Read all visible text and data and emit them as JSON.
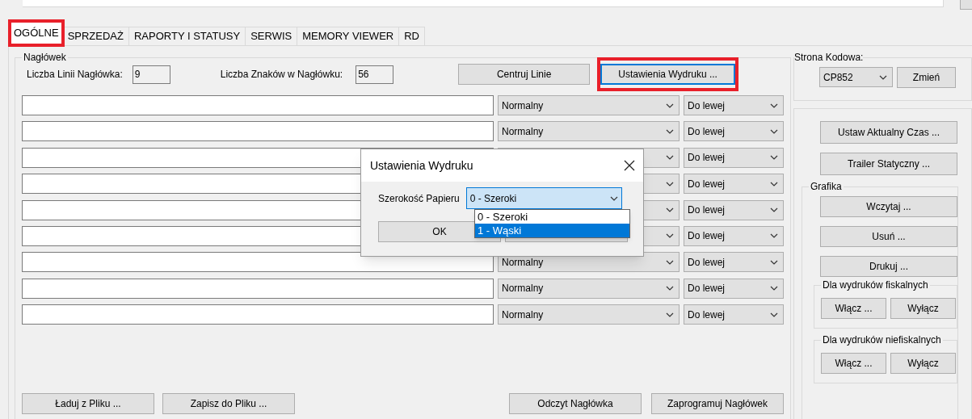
{
  "tabs": [
    {
      "label": "OGÓLNE",
      "selected": true,
      "highlighted": true
    },
    {
      "label": "SPRZEDAŻ",
      "selected": false,
      "highlighted": false
    },
    {
      "label": "RAPORTY I STATUSY",
      "selected": false,
      "highlighted": false
    },
    {
      "label": "SERWIS",
      "selected": false,
      "highlighted": false
    },
    {
      "label": "MEMORY VIEWER",
      "selected": false,
      "highlighted": false
    },
    {
      "label": "RD",
      "selected": false,
      "highlighted": false
    }
  ],
  "header_group": {
    "title": "Nagłówek",
    "line_count_label": "Liczba Linii Nagłówka:",
    "line_count": "9",
    "char_count_label": "Liczba Znaków w Nagłówku:",
    "char_count": "56",
    "buttons": [
      {
        "label": "Centruj Linie",
        "highlighted": false,
        "focused": false
      },
      {
        "label": "Ustawienia Wydruku ...",
        "highlighted": true,
        "focused": true
      }
    ]
  },
  "header_lines": [
    {
      "style": "Normalny",
      "align": "Do lewej"
    },
    {
      "style": "Normalny",
      "align": "Do lewej"
    },
    {
      "align": "Do lewej"
    },
    {
      "align": "Do lewej"
    },
    {
      "align": "Do lewej"
    },
    {
      "align": "Do lewej"
    },
    {
      "style": "Normalny",
      "align": "Do lewej"
    },
    {
      "style": "Normalny",
      "align": "Do lewej"
    },
    {
      "style": "Normalny",
      "align": "Do lewej"
    }
  ],
  "file_buttons": [
    "Ładuj z Pliku ...",
    "Zapisz do Pliku ..."
  ],
  "header_actions": [
    "Odczyt Nagłówka",
    "Zaprogramuj Nagłówek"
  ],
  "code_page": {
    "title": "Strona Kodowa:",
    "value": "CP852",
    "button": "Zmień"
  },
  "right_buttons": [
    "Ustaw Aktualny Czas ...",
    "Trailer Statyczny ..."
  ],
  "graphics": {
    "title": "Grafika",
    "buttons": [
      "Wczytaj ...",
      "Usuń ...",
      "Drukuj ..."
    ],
    "groups": [
      {
        "title": "Dla wydruków fiskalnych",
        "buttons": [
          "Włącz ...",
          "Wyłącz"
        ]
      },
      {
        "title": "Dla wydruków niefiskalnych",
        "buttons": [
          "Włącz ...",
          "Wyłącz"
        ]
      }
    ]
  },
  "dialog": {
    "title": "Ustawienia Wydruku",
    "label": "Szerokość Papieru",
    "value": "0 - Szeroki",
    "options": [
      {
        "label": "0 - Szeroki",
        "highlighted": false
      },
      {
        "label": "1 - Wąski",
        "highlighted": true
      }
    ],
    "buttons": [
      "OK"
    ]
  }
}
